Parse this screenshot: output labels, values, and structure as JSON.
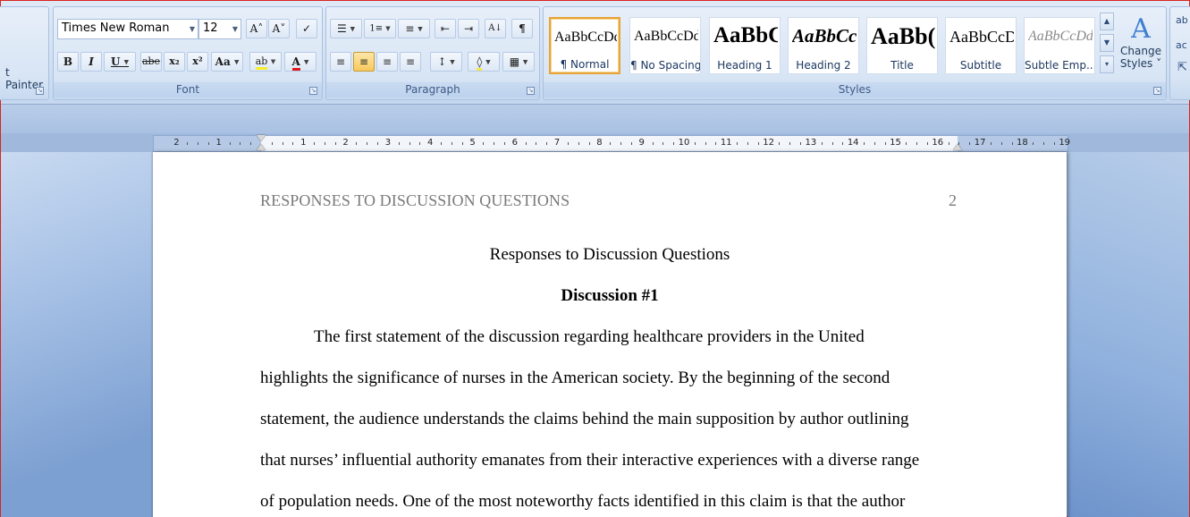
{
  "clipboard": {
    "painter_label": "t Painter"
  },
  "font": {
    "group_label": "Font",
    "font_name": "Times New Roman",
    "font_size": "12",
    "grow_label": "A˄",
    "shrink_label": "A˅",
    "clear_label": "✓",
    "bold": "B",
    "italic": "I",
    "underline": "U",
    "strike": "abe",
    "subscript": "x₂",
    "superscript": "x²",
    "change_case": "Aa",
    "highlight": "ab",
    "font_color": "A"
  },
  "paragraph": {
    "group_label": "Paragraph",
    "bullets": "☰",
    "numbering": "1≡",
    "multilevel": "≡",
    "decrease_indent": "⇤",
    "increase_indent": "⇥",
    "sort": "A↓",
    "show_marks": "¶",
    "align_left": "≡",
    "align_center": "≡",
    "align_right": "≡",
    "justify": "≡",
    "line_spacing": "↕",
    "shading": "◊",
    "borders": "▦"
  },
  "styles": {
    "group_label": "Styles",
    "gallery": [
      {
        "sample": "AaBbCcDd",
        "name": "¶ Normal"
      },
      {
        "sample": "AaBbCcDd",
        "name": "¶ No Spacing"
      },
      {
        "sample": "AaBbC(",
        "name": "Heading 1"
      },
      {
        "sample": "AaBbCc",
        "name": "Heading 2"
      },
      {
        "sample": "AaBb(",
        "name": "Title"
      },
      {
        "sample": "AaBbCcD",
        "name": "Subtitle"
      },
      {
        "sample": "AaBbCcDd",
        "name": "Subtle Emp..."
      }
    ],
    "change_styles_line1": "Change",
    "change_styles_line2": "Styles ˅",
    "change_styles_icon": "A"
  },
  "editing": {
    "find_icon_label": "ab",
    "replace_label": "ac"
  },
  "ruler": {
    "left_numbers": [
      "2",
      "1"
    ],
    "right_numbers": [
      "1",
      "2",
      "3",
      "4",
      "5",
      "6",
      "7",
      "8",
      "9",
      "10",
      "11",
      "12",
      "13",
      "14",
      "15",
      "16",
      "17",
      "18",
      "19"
    ]
  },
  "document": {
    "running_head": "RESPONSES TO DISCUSSION QUESTIONS",
    "page_number": "2",
    "title": "Responses to Discussion Questions",
    "heading": "Discussion #1",
    "lines": [
      "The first statement of the discussion regarding healthcare providers in the United",
      "highlights the significance of nurses in the American society. By the beginning of the second",
      "statement, the audience understands the claims behind the main supposition by author outlining",
      "that nurses’ influential authority emanates from their interactive experiences with a diverse range",
      "of population needs. One of the most noteworthy facts identified in this claim is that the author"
    ]
  }
}
